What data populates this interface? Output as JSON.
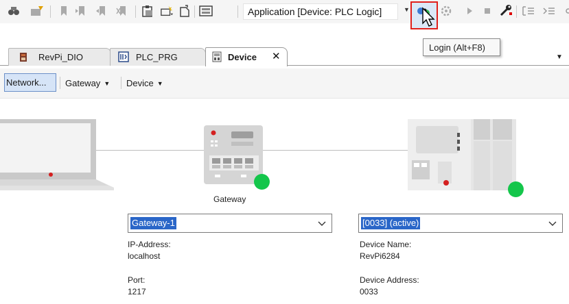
{
  "toolbar": {
    "application_selector": "Application [Device: PLC Logic]",
    "tooltip": "Login (Alt+F8)",
    "icons": [
      "find-icon",
      "find-replace-icon",
      "bookmark-icon",
      "bookmark-next-icon",
      "bookmark-prev-icon",
      "bookmark-clear-icon",
      "clipboard-icon",
      "device-add-icon",
      "export-icon",
      "library-icon",
      "login-icon",
      "logout-icon",
      "run-icon",
      "stop-icon",
      "build-icon",
      "step-icon",
      "step-over-icon"
    ]
  },
  "tabs": [
    {
      "label": "RevPi_DIO",
      "icon": "device-tab-icon",
      "active": false
    },
    {
      "label": "PLC_PRG",
      "icon": "program-tab-icon",
      "active": false
    },
    {
      "label": "Device",
      "icon": "device-editor-icon",
      "active": true,
      "closable": true
    }
  ],
  "subtoolbar": {
    "scan_network": "Network...",
    "gateway": "Gateway",
    "device": "Device"
  },
  "gateway": {
    "name": "Gateway",
    "selected": "Gateway-1",
    "ip_label": "IP-Address:",
    "ip_value": "localhost",
    "port_label": "Port:",
    "port_value": "1217",
    "status_color": "#14c64b"
  },
  "device": {
    "selected": "[0033] (active)",
    "name_label": "Device Name:",
    "name_value": "RevPi6284",
    "address_label": "Device Address:",
    "address_value": "0033",
    "status_color": "#14c64b"
  },
  "colors": {
    "accent": "#2a66c8",
    "login_highlight": "#e0201c"
  }
}
